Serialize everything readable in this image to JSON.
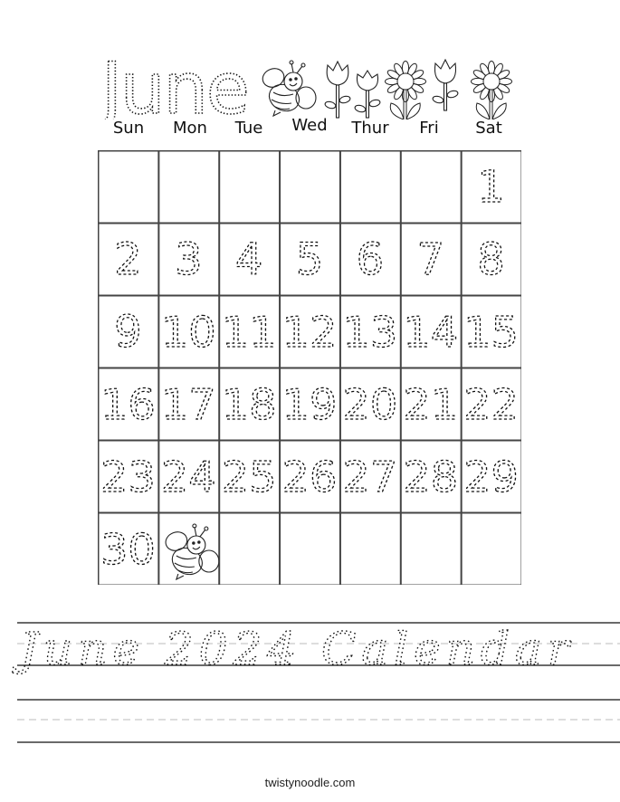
{
  "worksheet": {
    "month_title": "June",
    "weekdays": [
      "Sun",
      "Mon",
      "Tue",
      "Wed",
      "Thur",
      "Fri",
      "Sat"
    ],
    "calendar": {
      "first_weekday_index": 6,
      "days_in_month": 30,
      "weeks": [
        [
          "",
          "",
          "",
          "",
          "",
          "",
          "1"
        ],
        [
          "2",
          "3",
          "4",
          "5",
          "6",
          "7",
          "8"
        ],
        [
          "9",
          "10",
          "11",
          "12",
          "13",
          "14",
          "15"
        ],
        [
          "16",
          "17",
          "18",
          "19",
          "20",
          "21",
          "22"
        ],
        [
          "23",
          "24",
          "25",
          "26",
          "27",
          "28",
          "29"
        ],
        [
          "30",
          "bee-icon",
          "",
          "",
          "",
          "",
          ""
        ]
      ]
    },
    "header_icons": [
      "bee-icon",
      "tulip-icon",
      "tulip-icon",
      "daisy-icon",
      "tulip-icon",
      "daisy-icon"
    ],
    "tracing_text": "June 2024 Calendar",
    "footer": "twistynoodle.com"
  },
  "colors": {
    "ink": "#111111",
    "grid_line": "#444444",
    "guide_dash": "#bbbbbb",
    "background": "#ffffff"
  }
}
